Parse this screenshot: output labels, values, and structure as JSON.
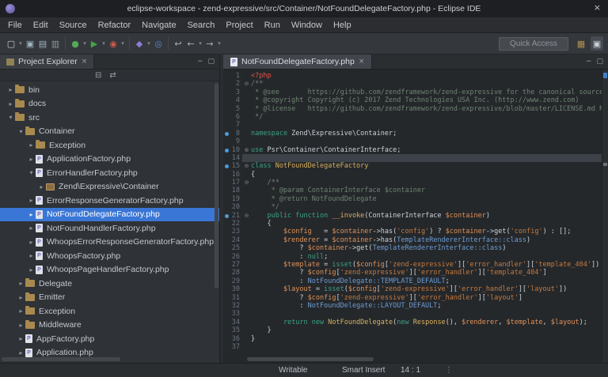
{
  "window": {
    "title": "eclipse-workspace - zend-expressive/src/Container/NotFoundDelegateFactory.php - Eclipse IDE",
    "close_glyph": "×"
  },
  "menu": {
    "items": [
      "File",
      "Edit",
      "Source",
      "Refactor",
      "Navigate",
      "Search",
      "Project",
      "Run",
      "Window",
      "Help"
    ]
  },
  "toolbar": {
    "quick_access_label": "Quick Access",
    "icons": [
      {
        "name": "new-wizard",
        "glyph": "▢",
        "color": "#c8d0d7"
      },
      {
        "name": "new-wizard-menu",
        "glyph": "▾",
        "color": "#848d95",
        "small": true
      },
      {
        "name": "save",
        "glyph": "▣",
        "color": "#9fb2c0"
      },
      {
        "name": "save-all",
        "glyph": "▤",
        "color": "#9fb2c0"
      },
      {
        "name": "print",
        "glyph": "▥",
        "color": "#8d99a3"
      },
      {
        "type": "sep"
      },
      {
        "name": "debug",
        "glyph": "●",
        "color": "#53a957"
      },
      {
        "name": "debug-menu",
        "glyph": "▾",
        "color": "#848d95",
        "small": true
      },
      {
        "name": "run",
        "glyph": "▶",
        "color": "#46a14b"
      },
      {
        "name": "run-menu",
        "glyph": "▾",
        "color": "#848d95",
        "small": true
      },
      {
        "name": "external-tools",
        "glyph": "◉",
        "color": "#cc5a4e"
      },
      {
        "name": "external-tools-menu",
        "glyph": "▾",
        "color": "#848d95",
        "small": true
      },
      {
        "type": "sep"
      },
      {
        "name": "new-php-element",
        "glyph": "◆",
        "color": "#8d7cd6"
      },
      {
        "name": "new-php-element-menu",
        "glyph": "▾",
        "color": "#848d95",
        "small": true
      },
      {
        "name": "search",
        "glyph": "◎",
        "color": "#4f8fd0"
      },
      {
        "type": "sep"
      },
      {
        "name": "last-edit-location",
        "glyph": "↩",
        "color": "#a9b3bc"
      },
      {
        "name": "back",
        "glyph": "←",
        "color": "#a9b3bc"
      },
      {
        "name": "back-menu",
        "glyph": "▾",
        "color": "#848d95",
        "small": true
      },
      {
        "name": "forward",
        "glyph": "→",
        "color": "#a9b3bc"
      },
      {
        "name": "forward-menu",
        "glyph": "▾",
        "color": "#848d95",
        "small": true
      }
    ],
    "perspectives": [
      {
        "name": "open-perspective",
        "glyph": "▦",
        "color": "#b3924c",
        "active": false
      },
      {
        "name": "php-perspective",
        "glyph": "▣",
        "color": "#c8d0d7",
        "active": true
      }
    ]
  },
  "explorer": {
    "tab_label": "Project Explorer",
    "tab_close": "×",
    "minimize_glyph": "−",
    "maximize_glyph": "▢",
    "toolbar_icons": [
      {
        "name": "collapse-all",
        "glyph": "⊟"
      },
      {
        "name": "link-with-editor",
        "glyph": "⇄"
      }
    ],
    "items": [
      {
        "label": "bin",
        "level": 1,
        "arrow": "right",
        "icon": "folder"
      },
      {
        "label": "docs",
        "level": 1,
        "arrow": "right",
        "icon": "folder"
      },
      {
        "label": "src",
        "level": 1,
        "arrow": "down",
        "icon": "folder"
      },
      {
        "label": "Container",
        "level": 2,
        "arrow": "down",
        "icon": "folder"
      },
      {
        "label": "Exception",
        "level": 3,
        "arrow": "right",
        "icon": "folder"
      },
      {
        "label": "ApplicationFactory.php",
        "level": 3,
        "arrow": "right",
        "icon": "php"
      },
      {
        "label": "ErrorHandlerFactory.php",
        "level": 3,
        "arrow": "down",
        "icon": "php"
      },
      {
        "label": "Zend\\Expressive\\Container",
        "level": 4,
        "arrow": "right",
        "icon": "pkg"
      },
      {
        "label": "ErrorResponseGeneratorFactory.php",
        "level": 3,
        "arrow": "right",
        "icon": "php"
      },
      {
        "label": "NotFoundDelegateFactory.php",
        "level": 3,
        "arrow": "right",
        "icon": "php",
        "selected": true
      },
      {
        "label": "NotFoundHandlerFactory.php",
        "level": 3,
        "arrow": "right",
        "icon": "php"
      },
      {
        "label": "WhoopsErrorResponseGeneratorFactory.php",
        "level": 3,
        "arrow": "right",
        "icon": "php"
      },
      {
        "label": "WhoopsFactory.php",
        "level": 3,
        "arrow": "right",
        "icon": "php"
      },
      {
        "label": "WhoopsPageHandlerFactory.php",
        "level": 3,
        "arrow": "right",
        "icon": "php"
      },
      {
        "label": "Delegate",
        "level": 2,
        "arrow": "right",
        "icon": "folder"
      },
      {
        "label": "Emitter",
        "level": 2,
        "arrow": "right",
        "icon": "folder"
      },
      {
        "label": "Exception",
        "level": 2,
        "arrow": "right",
        "icon": "folder"
      },
      {
        "label": "Middleware",
        "level": 2,
        "arrow": "right",
        "icon": "folder"
      },
      {
        "label": "AppFactory.php",
        "level": 2,
        "arrow": "right",
        "icon": "php"
      },
      {
        "label": "Application.php",
        "level": 2,
        "arrow": "right",
        "icon": "php"
      }
    ]
  },
  "editor": {
    "tab_label": "NotFoundDelegateFactory.php",
    "tab_close": "×",
    "lines": [
      {
        "n": 1,
        "segs": [
          [
            "tag",
            "<?php"
          ]
        ]
      },
      {
        "n": 2,
        "fold": "minus",
        "segs": [
          [
            "com",
            "/**"
          ]
        ]
      },
      {
        "n": 3,
        "segs": [
          [
            "com",
            " * @see       https://github.com/zendframework/zend-expressive for the canonical source re"
          ]
        ]
      },
      {
        "n": 4,
        "segs": [
          [
            "com",
            " * @copyright Copyright (c) 2017 Zend Technologies USA Inc. (http://www.zend.com)"
          ]
        ]
      },
      {
        "n": 5,
        "segs": [
          [
            "com",
            " * @license   https://github.com/zendframework/zend-expressive/blob/master/LICENSE.md New"
          ]
        ]
      },
      {
        "n": 6,
        "segs": [
          [
            "com",
            " */"
          ]
        ]
      },
      {
        "n": 7,
        "segs": []
      },
      {
        "n": 8,
        "marker": true,
        "segs": [
          [
            "kw",
            "namespace"
          ],
          [
            "plain",
            " Zend\\Expressive\\Container;"
          ]
        ]
      },
      {
        "n": 9,
        "segs": []
      },
      {
        "n": 10,
        "marker": true,
        "fold": "plus",
        "segs": [
          [
            "kw",
            "use"
          ],
          [
            "plain",
            " Psr\\Container\\ContainerInterface;"
          ]
        ]
      },
      {
        "n": 14,
        "current": true,
        "segs": []
      },
      {
        "n": 15,
        "marker": true,
        "fold": "minus",
        "segs": [
          [
            "kw",
            "class"
          ],
          [
            "cls",
            " NotFoundDelegateFactory"
          ]
        ]
      },
      {
        "n": 16,
        "segs": [
          [
            "plain",
            "{"
          ]
        ]
      },
      {
        "n": 17,
        "fold": "minus",
        "segs": [
          [
            "com",
            "    /**"
          ]
        ]
      },
      {
        "n": 18,
        "segs": [
          [
            "com",
            "     * @param ContainerInterface $container"
          ]
        ]
      },
      {
        "n": 19,
        "segs": [
          [
            "com",
            "     * @return NotFoundDelegate"
          ]
        ]
      },
      {
        "n": 20,
        "segs": [
          [
            "com",
            "     */"
          ]
        ]
      },
      {
        "n": 21,
        "marker": true,
        "fold": "minus",
        "segs": [
          [
            "kw",
            "    public function "
          ],
          [
            "cls",
            "__invoke"
          ],
          [
            "plain",
            "(ContainerInterface"
          ],
          [
            "var",
            " $container"
          ],
          [
            "plain",
            ")"
          ]
        ]
      },
      {
        "n": 22,
        "segs": [
          [
            "plain",
            "    {"
          ]
        ]
      },
      {
        "n": 23,
        "segs": [
          [
            "var",
            "        $config"
          ],
          [
            "plain",
            "   = "
          ],
          [
            "var",
            "$container"
          ],
          [
            "plain",
            "->has("
          ],
          [
            "str",
            "'config'"
          ],
          [
            "plain",
            ") ? "
          ],
          [
            "var",
            "$container"
          ],
          [
            "plain",
            "->get("
          ],
          [
            "str",
            "'config'"
          ],
          [
            "plain",
            ") : [];"
          ]
        ]
      },
      {
        "n": 24,
        "segs": [
          [
            "var",
            "        $renderer"
          ],
          [
            "plain",
            " = "
          ],
          [
            "var",
            "$container"
          ],
          [
            "plain",
            "->has("
          ],
          [
            "const",
            "TemplateRendererInterface::class"
          ],
          [
            "plain",
            ")"
          ]
        ]
      },
      {
        "n": 25,
        "segs": [
          [
            "plain",
            "            ? "
          ],
          [
            "var",
            "$container"
          ],
          [
            "plain",
            "->get("
          ],
          [
            "const",
            "TemplateRendererInterface::class"
          ],
          [
            "plain",
            ")"
          ]
        ]
      },
      {
        "n": 26,
        "segs": [
          [
            "plain",
            "            : "
          ],
          [
            "kw",
            "null"
          ],
          [
            "plain",
            ";"
          ]
        ]
      },
      {
        "n": 27,
        "segs": [
          [
            "var",
            "        $template"
          ],
          [
            "plain",
            " = "
          ],
          [
            "kw",
            "isset"
          ],
          [
            "plain",
            "("
          ],
          [
            "var",
            "$config"
          ],
          [
            "plain",
            "["
          ],
          [
            "str",
            "'zend-expressive'"
          ],
          [
            "plain",
            "]["
          ],
          [
            "str",
            "'error_handler'"
          ],
          [
            "plain",
            "]["
          ],
          [
            "str",
            "'template_404'"
          ],
          [
            "plain",
            "])"
          ]
        ]
      },
      {
        "n": 28,
        "segs": [
          [
            "plain",
            "            ? "
          ],
          [
            "var",
            "$config"
          ],
          [
            "plain",
            "["
          ],
          [
            "str",
            "'zend-expressive'"
          ],
          [
            "plain",
            "]["
          ],
          [
            "str",
            "'error_handler'"
          ],
          [
            "plain",
            "]["
          ],
          [
            "str",
            "'template_404'"
          ],
          [
            "plain",
            "]"
          ]
        ]
      },
      {
        "n": 29,
        "segs": [
          [
            "plain",
            "            : "
          ],
          [
            "const",
            "NotFoundDelegate::TEMPLATE_DEFAULT"
          ],
          [
            "plain",
            ";"
          ]
        ]
      },
      {
        "n": 30,
        "segs": [
          [
            "var",
            "        $layout"
          ],
          [
            "plain",
            " = "
          ],
          [
            "kw",
            "isset"
          ],
          [
            "plain",
            "("
          ],
          [
            "var",
            "$config"
          ],
          [
            "plain",
            "["
          ],
          [
            "str",
            "'zend-expressive'"
          ],
          [
            "plain",
            "]["
          ],
          [
            "str",
            "'error_handler'"
          ],
          [
            "plain",
            "]["
          ],
          [
            "str",
            "'layout'"
          ],
          [
            "plain",
            "])"
          ]
        ]
      },
      {
        "n": 31,
        "segs": [
          [
            "plain",
            "            ? "
          ],
          [
            "var",
            "$config"
          ],
          [
            "plain",
            "["
          ],
          [
            "str",
            "'zend-expressive'"
          ],
          [
            "plain",
            "]["
          ],
          [
            "str",
            "'error_handler'"
          ],
          [
            "plain",
            "]["
          ],
          [
            "str",
            "'layout'"
          ],
          [
            "plain",
            "]"
          ]
        ]
      },
      {
        "n": 32,
        "segs": [
          [
            "plain",
            "            : "
          ],
          [
            "const",
            "NotFoundDelegate::LAYOUT_DEFAULT"
          ],
          [
            "plain",
            ";"
          ]
        ]
      },
      {
        "n": 33,
        "segs": []
      },
      {
        "n": 34,
        "segs": [
          [
            "kw",
            "        return new "
          ],
          [
            "cls",
            "NotFoundDelegate"
          ],
          [
            "plain",
            "("
          ],
          [
            "kw",
            "new "
          ],
          [
            "cls",
            "Response"
          ],
          [
            "plain",
            "(), "
          ],
          [
            "var",
            "$renderer"
          ],
          [
            "plain",
            ", "
          ],
          [
            "var",
            "$template"
          ],
          [
            "plain",
            ", "
          ],
          [
            "var",
            "$layout"
          ],
          [
            "plain",
            ");"
          ]
        ]
      },
      {
        "n": 35,
        "segs": [
          [
            "plain",
            "    }"
          ]
        ]
      },
      {
        "n": 36,
        "segs": [
          [
            "plain",
            "}"
          ]
        ]
      },
      {
        "n": 37,
        "segs": []
      }
    ]
  },
  "statusbar": {
    "writable": "Writable",
    "input_mode": "Smart Insert",
    "cursor_position": "14 : 1",
    "overflow_glyph": "⋮"
  },
  "colors": {
    "selection": "#3a76d6",
    "syntax": {
      "tag": "#e0564a",
      "com": "#6f8273",
      "kw": "#3aa183",
      "cls": "#d8b15f",
      "var": "#e09158",
      "str": "#c57a3f",
      "const": "#6d9bd3",
      "plain": "#ccd2d8"
    }
  }
}
